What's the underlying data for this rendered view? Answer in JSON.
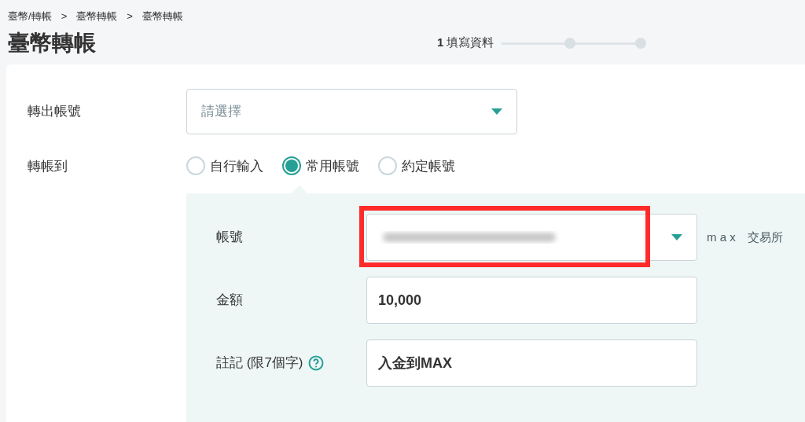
{
  "breadcrumb": [
    "臺幣/轉帳",
    "臺幣轉帳",
    "臺幣轉帳"
  ],
  "breadcrumb_separator": ">",
  "title": "臺幣轉帳",
  "stepper": {
    "number": "1",
    "label": "填寫資料",
    "dots": [
      {
        "active": false
      },
      {
        "active": false
      }
    ]
  },
  "from_account": {
    "label": "轉出帳號",
    "placeholder": "請選擇"
  },
  "transfer_to": {
    "label": "轉帳到",
    "options": [
      {
        "label": "自行輸入",
        "selected": false
      },
      {
        "label": "常用帳號",
        "selected": true
      },
      {
        "label": "約定帳號",
        "selected": false
      }
    ]
  },
  "panel": {
    "account": {
      "label": "帳號",
      "suffix": "m a x　交易所",
      "highlighted": true
    },
    "amount": {
      "label": "金額",
      "value": "10,000"
    },
    "memo": {
      "label": "註記 (限7個字)",
      "value": "入金到MAX"
    }
  }
}
